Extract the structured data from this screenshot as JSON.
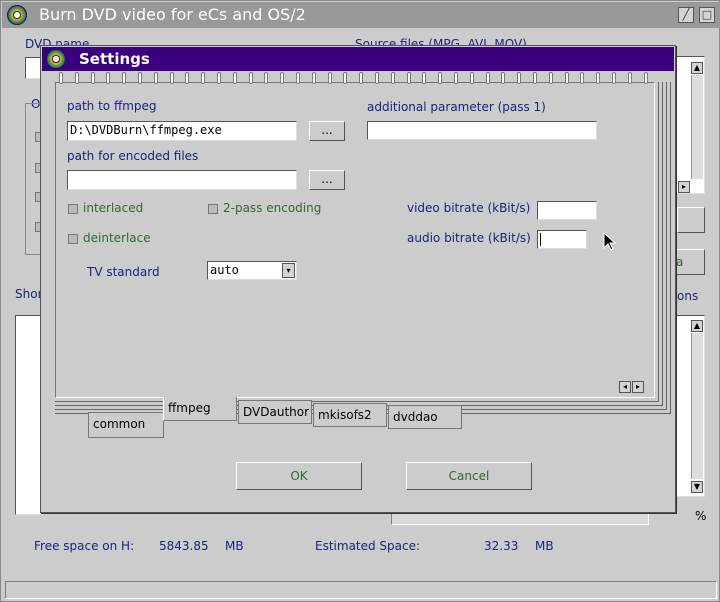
{
  "main": {
    "title": "Burn DVD video for eCs and OS/2",
    "dvd_name_label": "DVD name",
    "source_files_label": "Source files (MPG, AVI, MOV)",
    "options_group_label": "O",
    "short_label": "Shor",
    "options_partial_label": "ons",
    "side_button_partial": "a",
    "percent_sign": "%",
    "free_space_label": "Free space on H:",
    "free_space_value": "5843.85",
    "free_space_unit": "MB",
    "estimated_label": "Estimated Space:",
    "estimated_value": "32.33",
    "estimated_unit": "MB"
  },
  "settings": {
    "title": "Settings",
    "ffmpeg_path_label": "path to ffmpeg",
    "ffmpeg_path_value": "D:\\DVDBurn\\ffmpeg.exe",
    "browse_label": "...",
    "encoded_path_label": "path for encoded files",
    "encoded_path_value": "",
    "additional_param_label": "additional parameter (pass 1)",
    "additional_param_value": "",
    "interlaced_label": "interlaced",
    "twopass_label": "2-pass encoding",
    "deinterlace_label": "deinterlace",
    "video_bitrate_label": "video bitrate (kBit/s)",
    "video_bitrate_value": "",
    "audio_bitrate_label": "audio bitrate (kBit/s)",
    "audio_bitrate_value": "",
    "tv_standard_label": "TV standard",
    "tv_standard_value": "auto",
    "tabs": {
      "common": "common",
      "ffmpeg": "ffmpeg",
      "dvdauthor": "DVDauthor",
      "mkisofs": "mkisofs2",
      "dvddao": "dvddao"
    },
    "ok_label": "OK",
    "cancel_label": "Cancel"
  },
  "icons": {
    "app": "disc-icon",
    "close": "close-icon",
    "restore": "restore-icon",
    "dropdown": "chevron-down-icon",
    "scroll_up": "arrow-up-icon",
    "scroll_down": "arrow-down-icon",
    "page_prev": "arrow-left-icon",
    "page_next": "arrow-right-icon",
    "cursor": "mouse-pointer-icon"
  },
  "colors": {
    "settings_titlebar": "#3b0080",
    "main_titlebar": "#999999",
    "label_blue": "#1a237e",
    "disabled_green": "#336633"
  }
}
